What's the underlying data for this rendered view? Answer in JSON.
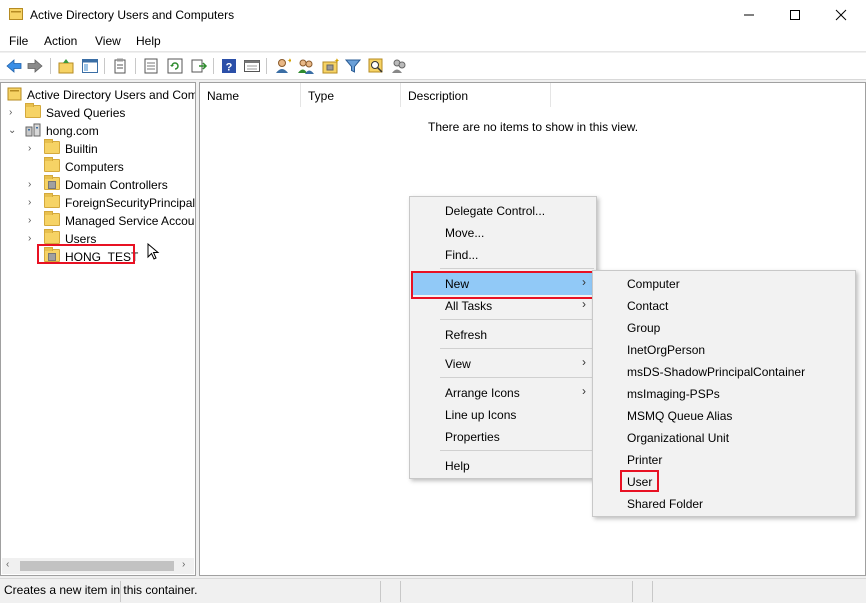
{
  "window": {
    "title": "Active Directory Users and Computers",
    "minimize_icon": "minimize-icon",
    "maximize_icon": "maximize-icon",
    "close_icon": "close-icon"
  },
  "menubar": {
    "items": [
      "File",
      "Action",
      "View",
      "Help"
    ]
  },
  "toolbar": {
    "icons": [
      "back-arrow-icon",
      "forward-arrow-icon",
      "up-folder-icon",
      "show-hide-tree-icon",
      "clipboard-icon",
      "export-list-icon",
      "refresh-icon",
      "export-icon",
      "help-icon",
      "console-view-icon",
      "new-user-icon",
      "new-group-icon",
      "new-ou-icon",
      "filter-icon",
      "find-icon",
      "add-to-group-icon"
    ]
  },
  "tree": {
    "root": "Active Directory Users and Com",
    "saved_queries": "Saved Queries",
    "domain": "hong.com",
    "children": [
      "Builtin",
      "Computers",
      "Domain Controllers",
      "ForeignSecurityPrincipals",
      "Managed Service Accour",
      "Users",
      "HONG_TEST"
    ]
  },
  "list": {
    "columns": [
      "Name",
      "Type",
      "Description"
    ],
    "empty_message": "There are no items to show in this view."
  },
  "context_menu": {
    "items": [
      "Delegate Control...",
      "Move...",
      "Find...",
      "New",
      "All Tasks",
      "Refresh",
      "View",
      "Arrange Icons",
      "Line up Icons",
      "Properties",
      "Help"
    ],
    "submenu_arrow": "›"
  },
  "new_submenu": {
    "items": [
      "Computer",
      "Contact",
      "Group",
      "InetOrgPerson",
      "msDS-ShadowPrincipalContainer",
      "msImaging-PSPs",
      "MSMQ Queue Alias",
      "Organizational Unit",
      "Printer",
      "User",
      "Shared Folder"
    ]
  },
  "statusbar": {
    "text": "Creates a new item in this container."
  },
  "colors": {
    "highlight_box": "#e81123",
    "menu_active": "#91c9f7",
    "folder": "#f6d365"
  }
}
